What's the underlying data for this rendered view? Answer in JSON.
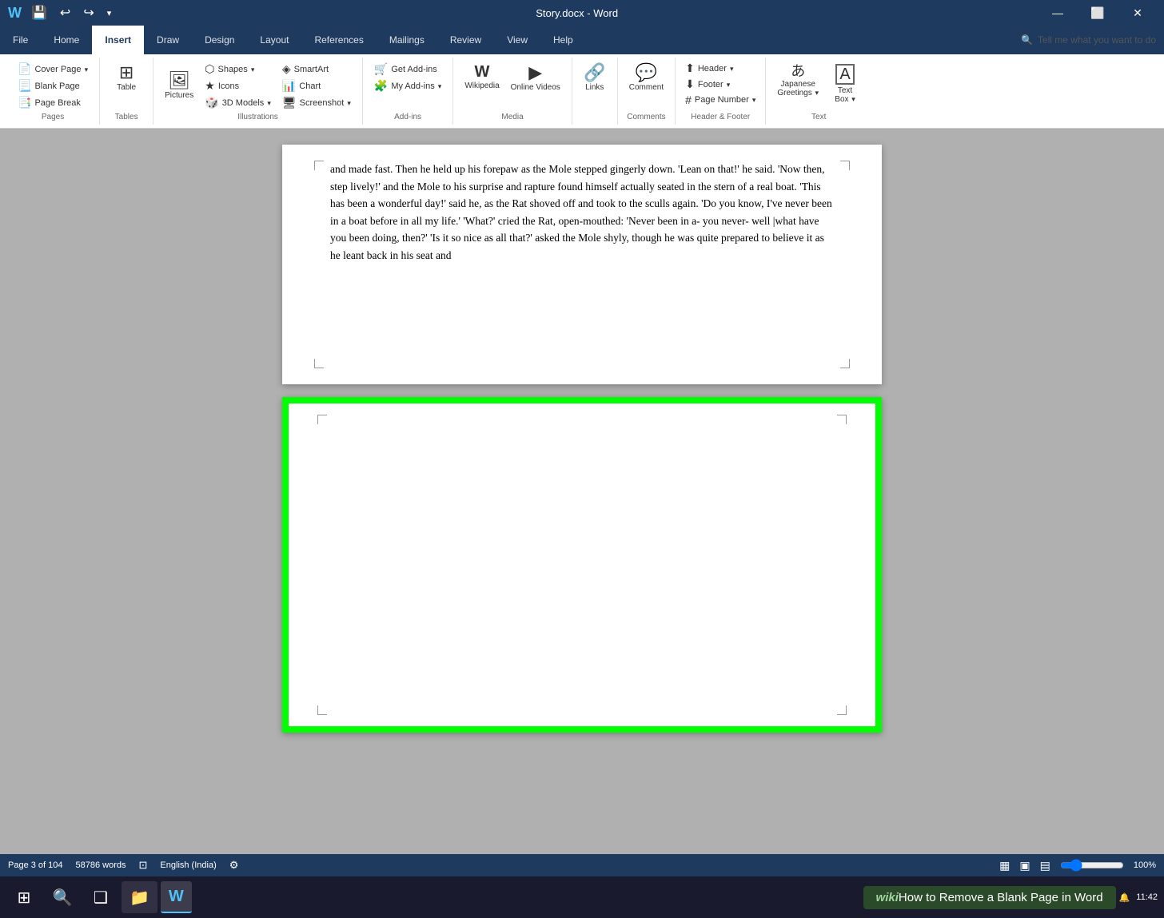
{
  "titleBar": {
    "title": "Story.docx - Word",
    "quickAccess": [
      "💾",
      "↩",
      "↪",
      "▾"
    ],
    "windowControls": [
      "—",
      "⬜",
      "✕"
    ]
  },
  "ribbon": {
    "tabs": [
      "File",
      "Home",
      "Insert",
      "Draw",
      "Design",
      "Layout",
      "References",
      "Mailings",
      "Review",
      "View",
      "Help"
    ],
    "activeTab": "Insert",
    "groups": {
      "pages": {
        "label": "Pages",
        "buttons": [
          "Cover Page ▾",
          "Blank Page",
          "Page Break"
        ]
      },
      "tables": {
        "label": "Tables",
        "button": "Table"
      },
      "illustrations": {
        "label": "Illustrations",
        "buttons": [
          "Pictures",
          "Shapes ▾",
          "Icons",
          "3D Models ▾",
          "SmartArt",
          "Chart",
          "Screenshot ▾"
        ]
      },
      "addins": {
        "label": "Add-ins",
        "buttons": [
          "Get Add-ins",
          "My Add-ins ▾"
        ]
      },
      "media": {
        "label": "Media",
        "buttons": [
          "Wikipedia",
          "Online Videos"
        ]
      },
      "links": {
        "label": "",
        "button": "Links"
      },
      "comments": {
        "label": "Comments",
        "button": "Comment"
      },
      "headerFooter": {
        "label": "Header & Footer",
        "buttons": [
          "Header ▾",
          "Footer ▾",
          "Page Number ▾"
        ]
      },
      "text": {
        "label": "Text",
        "buttons": [
          "Japanese Greetings ▾",
          "Text Box ▾"
        ]
      }
    },
    "tellMe": "Tell me what you want to do"
  },
  "document": {
    "content": "and made fast. Then he held up his forepaw as the Mole stepped gingerly down. 'Lean on that!' he said. 'Now then, step lively!' and the Mole to his surprise and rapture found himself actually seated in the stern of a real boat. 'This has been a wonderful day!' said he, as the Rat shoved off and took to the sculls again. 'Do you know, I've never been in a boat before in all my life.' 'What?' cried the Rat, open-mouthed: 'Never been in a- you never- well |what have you been doing, then?' 'Is it so nice as all that?' asked the Mole shyly, though he was quite prepared to believe it as he leant back in his seat and"
  },
  "statusBar": {
    "page": "Page 3 of 104",
    "words": "58786 words",
    "language": "English (India)",
    "viewIcons": [
      "▦",
      "▣",
      "▤"
    ]
  },
  "taskbar": {
    "startBtn": "⊞",
    "searchBtn": "🔍",
    "taskView": "❑",
    "apps": [
      "📁",
      "🔵"
    ],
    "wordIcon": "W"
  },
  "wikihow": {
    "prefix": "wiki",
    "text": "How to Remove a Blank Page in Word"
  }
}
